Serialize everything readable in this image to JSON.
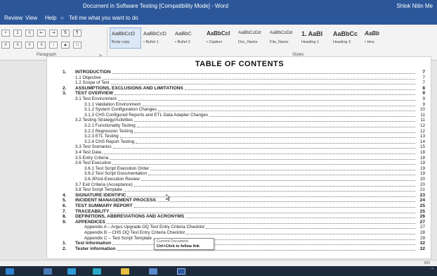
{
  "window": {
    "title": "Document in Software Testing [Compatibility Mode] - Word",
    "user": "Shlok Nitin Me"
  },
  "menu": {
    "items": [
      "Review",
      "View",
      "Help"
    ],
    "tell_me": "Tell me what you want to do"
  },
  "ribbon": {
    "paragraph_label": "Paragraph",
    "styles_label": "Styles",
    "styles": [
      {
        "sample": "AaBbCcD",
        "name": "Body copy"
      },
      {
        "sample": "AaBbCcD",
        "name": "• Bullet 1"
      },
      {
        "sample": "AaBbC",
        "name": "• Bullet 2"
      },
      {
        "sample": "AaBbCcI",
        "name": "• Caption"
      },
      {
        "sample": "AaBbCcDd",
        "name": "Doc_Name"
      },
      {
        "sample": "AaBbCcDd",
        "name": "File_Name"
      },
      {
        "sample": "1. AaBI",
        "name": "Heading 1"
      },
      {
        "sample": "AaBbCc",
        "name": "Heading 3"
      },
      {
        "sample": "AaBb",
        "name": "• Hea"
      }
    ]
  },
  "document": {
    "toc_title": "TABLE OF CONTENTS",
    "entries": [
      {
        "num": "1.",
        "text": "INTRODUCTION",
        "page": "7",
        "level": 1
      },
      {
        "num": "",
        "text": "1.1 Objective",
        "page": "7",
        "level": 2
      },
      {
        "num": "",
        "text": "1.2 Scope of Test",
        "page": "7",
        "level": 2
      },
      {
        "num": "2.",
        "text": "ASSUMPTIONS, EXCLUSIONS AND LIMITATIONS",
        "page": "8",
        "level": 1
      },
      {
        "num": "3.",
        "text": "TEST OVERVIEW",
        "page": "9",
        "level": 1
      },
      {
        "num": "",
        "text": "3.1 Test Environment",
        "page": "9",
        "level": 2
      },
      {
        "num": "",
        "text": "3.1.1 Validation Environment",
        "page": "9",
        "level": 3
      },
      {
        "num": "",
        "text": "3.1.2 System Configuration Changes",
        "page": "10",
        "level": 3
      },
      {
        "num": "",
        "text": "3.1.3 CHS Configured Reports and ETL Data Adapter Changes",
        "page": "11",
        "level": 3
      },
      {
        "num": "",
        "text": "3.2 Testing Strategy/Activities",
        "page": "11",
        "level": 2
      },
      {
        "num": "",
        "text": "3.2.1 Functionality Testing",
        "page": "12",
        "level": 3
      },
      {
        "num": "",
        "text": "3.2.2 Regression Testing",
        "page": "12",
        "level": 3
      },
      {
        "num": "",
        "text": "3.2.3 ETL Testing",
        "page": "13",
        "level": 3
      },
      {
        "num": "",
        "text": "3.2.4 CHS Report Testing",
        "page": "14",
        "level": 3
      },
      {
        "num": "",
        "text": "3.3 Test Scenarios",
        "page": "15",
        "level": 2
      },
      {
        "num": "",
        "text": "3.4 Test Data",
        "page": "18",
        "level": 2
      },
      {
        "num": "",
        "text": "3.5 Entry Criteria",
        "page": "18",
        "level": 2
      },
      {
        "num": "",
        "text": "3.6 Test Execution",
        "page": "19",
        "level": 2
      },
      {
        "num": "",
        "text": "3.6.1 Test Script Execution Order",
        "page": "19",
        "level": 3
      },
      {
        "num": "",
        "text": "3.6.2 Test Script Documentation",
        "page": "19",
        "level": 3
      },
      {
        "num": "",
        "text": "3.6.3Post-Execution Review",
        "page": "20",
        "level": 3
      },
      {
        "num": "",
        "text": "3.7 Exit Criteria (Acceptance)",
        "page": "20",
        "level": 2
      },
      {
        "num": "",
        "text": "3.8 Test Script Template",
        "page": "21",
        "level": 2
      },
      {
        "num": "4.",
        "text": "SIGNATURE IDENTIFIC",
        "page": "23",
        "level": 1
      },
      {
        "num": "5.",
        "text": "INCIDENT MANAGEMENT PROCESS",
        "page": "24",
        "level": 1
      },
      {
        "num": "6.",
        "text": "TEST SUMMARY REPORT",
        "page": "25",
        "level": 1
      },
      {
        "num": "7.",
        "text": "TRACEABILITY",
        "page": "25",
        "level": 1
      },
      {
        "num": "8.",
        "text": "DEFINITIONS, ABBREVIATIONS AND ACRONYMS",
        "page": "26",
        "level": 1
      },
      {
        "num": "9.",
        "text": "APPENDICES",
        "page": "27",
        "level": 1
      },
      {
        "num": "",
        "text": "Appendix A – Argus Upgrade OQ Test Entry Criteria Checklist",
        "page": "27",
        "level": 3
      },
      {
        "num": "",
        "text": "Appendix B – CHS OQ Test Entry Criteria Checklist",
        "page": "28",
        "level": 3
      },
      {
        "num": "",
        "text": "Appendix C – Test Script Template",
        "page": "29",
        "level": 3
      },
      {
        "num": "1.",
        "text": "Test Information",
        "page": "32",
        "level": 1
      },
      {
        "num": "2.",
        "text": "Tester information",
        "page": "32",
        "level": 1
      }
    ]
  },
  "tooltip": {
    "title": "Current Document",
    "hint": "Ctrl+Click to follow link"
  },
  "status": {
    "right": "889"
  },
  "taskbar": {
    "icons": [
      "windows-icon",
      "file-explorer-icon",
      "edge-icon",
      "store-icon",
      "chrome-icon",
      "mail-icon",
      "word-icon"
    ]
  }
}
